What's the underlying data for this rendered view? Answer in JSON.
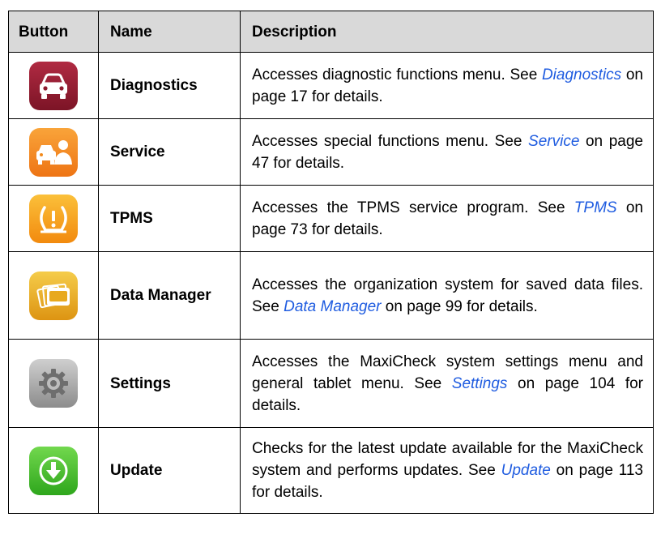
{
  "table": {
    "headers": {
      "button": "Button",
      "name": "Name",
      "description": "Description"
    },
    "rows": [
      {
        "icon": "car-front-icon",
        "color": "#8e1a2e",
        "name": "Diagnostics",
        "desc_before": "Accesses diagnostic functions menu. See ",
        "link": "Diagnostics",
        "desc_after": " on page 17 for details."
      },
      {
        "icon": "car-mechanic-icon",
        "color": "#f28a1c",
        "name": "Service",
        "desc_before": "Accesses special functions menu. See ",
        "link": "Service",
        "desc_after": " on page 47 for details."
      },
      {
        "icon": "tire-pressure-warning-icon",
        "color": "#f7a11a",
        "name": "TPMS",
        "desc_before": "Accesses the TPMS service program. See ",
        "link": "TPMS",
        "desc_after": " on page 73 for details."
      },
      {
        "icon": "cpm-data-files-icon",
        "color": "#e8a91e",
        "name": "Data Manager",
        "desc_before": "Accesses the organization system for saved data files. See ",
        "link": "Data Manager",
        "desc_after": " on page 99 for details."
      },
      {
        "icon": "gear-icon",
        "color": "#a6a6a6",
        "name": "Settings",
        "desc_before": "Accesses the MaxiCheck system settings menu and general tablet menu. See ",
        "link": "Settings",
        "desc_after": " on page 104 for details."
      },
      {
        "icon": "download-arrow-icon",
        "color": "#4cbf2e",
        "name": "Update",
        "desc_before": "Checks for the latest update available for the MaxiCheck system and performs updates. See ",
        "link": "Update",
        "desc_after": " on page 113 for details."
      }
    ]
  }
}
